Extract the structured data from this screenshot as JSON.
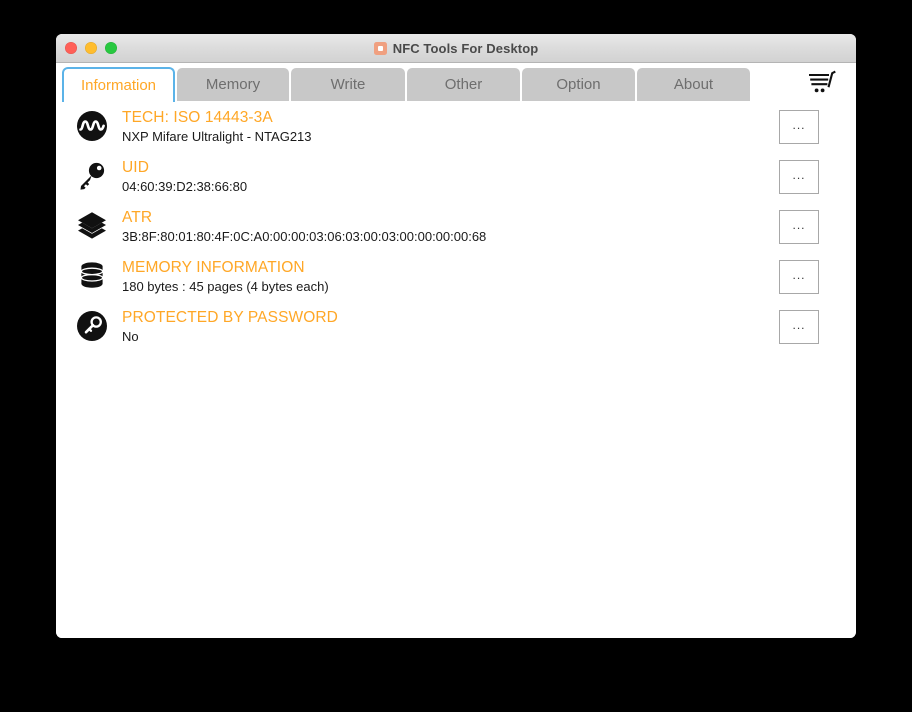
{
  "window": {
    "title": "NFC Tools For Desktop",
    "app_icon": "app-icon",
    "traffic_lights": {
      "close": "close-button",
      "minimize": "minimize-button",
      "maximize": "maximize-button"
    }
  },
  "tabs": [
    {
      "label": "Information",
      "active": true
    },
    {
      "label": "Memory",
      "active": false
    },
    {
      "label": "Write",
      "active": false
    },
    {
      "label": "Other",
      "active": false
    },
    {
      "label": "Option",
      "active": false
    },
    {
      "label": "About",
      "active": false
    }
  ],
  "toolbar": {
    "cart_icon": "shopping-cart-icon"
  },
  "rows": [
    {
      "icon": "nfc-wave-icon",
      "title": "TECH: ISO 14443-3A",
      "value": "NXP Mifare Ultralight - NTAG213",
      "button": "..."
    },
    {
      "icon": "key-icon",
      "title": "UID",
      "value": "04:60:39:D2:38:66:80",
      "button": "..."
    },
    {
      "icon": "layers-icon",
      "title": "ATR",
      "value": "3B:8F:80:01:80:4F:0C:A0:00:00:03:06:03:00:03:00:00:00:00:68",
      "button": "..."
    },
    {
      "icon": "database-icon",
      "title": "MEMORY INFORMATION",
      "value": "180 bytes : 45 pages (4 bytes each)",
      "button": "..."
    },
    {
      "icon": "password-key-icon",
      "title": "PROTECTED BY PASSWORD",
      "value": "No",
      "button": "..."
    }
  ],
  "colors": {
    "accent_orange": "#ffa726",
    "active_tab_border": "#5bb3e8",
    "tab_inactive_bg": "#c8c8c8",
    "desktop_bg": "#000000"
  }
}
